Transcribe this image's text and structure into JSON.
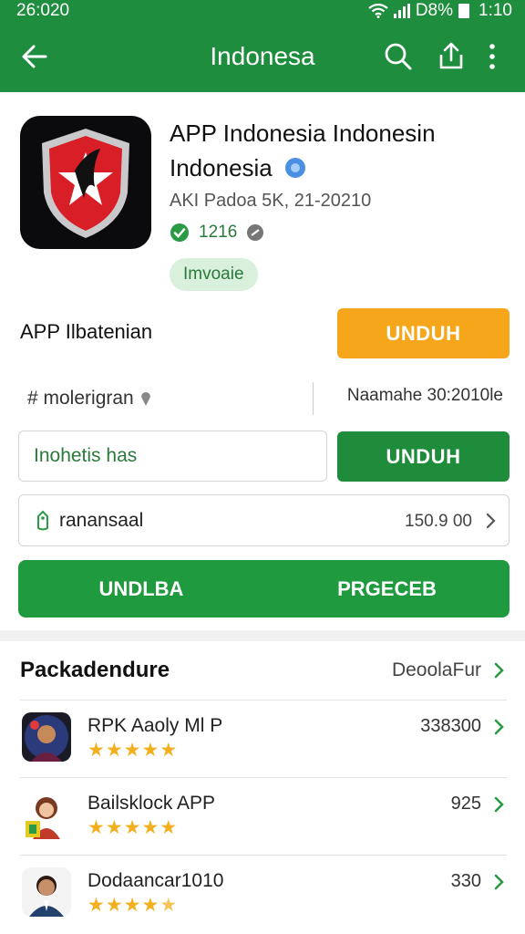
{
  "status_bar": {
    "time_left": "26:020",
    "battery": "D8%",
    "clock": "1:10"
  },
  "app_bar": {
    "title": "Indonesa"
  },
  "app": {
    "name_line1": "APP Indonesia Indonesin",
    "name_line2": "Indonesia",
    "meta": "AKI Padoa 5K, 21-20210",
    "rating_count": "1216",
    "chip": "Imvoaie"
  },
  "section_label": "APP Ilbatenian",
  "download_orange": "UNDUH",
  "tagline": "# molerigran",
  "size_text": "Naamahe 30:2010le",
  "input_value": "Inohetis has",
  "download_green": "UNDUH",
  "row": {
    "label": "ranansaal",
    "value": "150.9 00"
  },
  "big_button": {
    "left": "UNDLBA",
    "right": "PRGECEB"
  },
  "list": {
    "heading": "Packadendure",
    "more": "DeoolaFur",
    "items": [
      {
        "name": "RPK Aaoly Ml P",
        "value": "338300",
        "rating": 5
      },
      {
        "name": "Bailsklock APP",
        "value": "925",
        "rating": 5
      },
      {
        "name": "Dodaancar1010",
        "value": "330",
        "rating": 4.5
      }
    ]
  },
  "colors": {
    "primary": "#1e8e3e",
    "accent": "#f6a61a",
    "star": "#f2b01e"
  }
}
